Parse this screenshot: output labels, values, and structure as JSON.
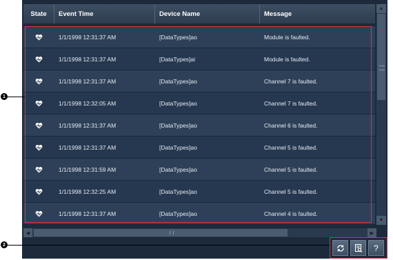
{
  "columns": {
    "state": "State",
    "event_time": "Event Time",
    "device_name": "Device Name",
    "message": "Message"
  },
  "rows": [
    {
      "time": "1/1/1998 12:31:37 AM",
      "device": "[DataTypes]ao",
      "message": "Module is faulted."
    },
    {
      "time": "1/1/1998 12:31:37 AM",
      "device": "[DataTypes]ai",
      "message": "Module is faulted."
    },
    {
      "time": "1/1/1998 12:31:37 AM",
      "device": "[DataTypes]ao",
      "message": "Channel 7 is faulted."
    },
    {
      "time": "1/1/1998 12:32:05 AM",
      "device": "[DataTypes]ao",
      "message": "Channel 7 is faulted."
    },
    {
      "time": "1/1/1998 12:31:37 AM",
      "device": "[DataTypes]ao",
      "message": "Channel 6 is faulted."
    },
    {
      "time": "1/1/1998 12:31:37 AM",
      "device": "[DataTypes]ao",
      "message": "Channel 5 is faulted."
    },
    {
      "time": "1/1/1998 12:31:59 AM",
      "device": "[DataTypes]ao",
      "message": "Channel 5 is faulted."
    },
    {
      "time": "1/1/1998 12:32:25 AM",
      "device": "[DataTypes]ao",
      "message": "Channel 5 is faulted."
    },
    {
      "time": "1/1/1998 12:31:37 AM",
      "device": "[DataTypes]ao",
      "message": "Channel 4 is faulted."
    }
  ],
  "icons": {
    "state": "fault-heartbeat-icon",
    "refresh": "refresh-icon",
    "details": "details-icon",
    "help": "help-icon"
  },
  "toolbar": {
    "help_label": "?"
  },
  "callouts": {
    "one": "1",
    "two": "2"
  },
  "colors": {
    "panel_bg": "#1c2a3c",
    "row_odd": "#2e4058",
    "row_even": "#263850",
    "highlight": "#e0323c"
  }
}
